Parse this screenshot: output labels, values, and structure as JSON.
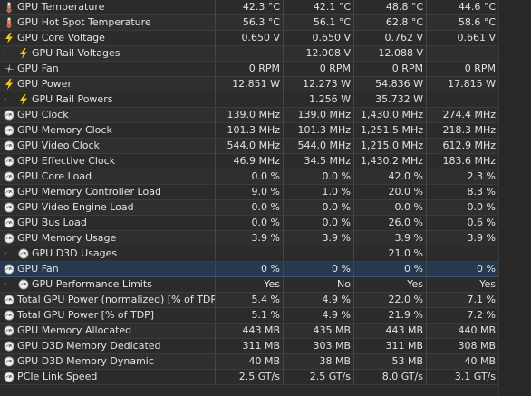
{
  "sensors": [
    {
      "name": "GPU Temperature",
      "icon": "thermometer-icon",
      "values": [
        "42.3 °C",
        "42.1 °C",
        "48.8 °C",
        "44.6 °C"
      ]
    },
    {
      "name": "GPU Hot Spot Temperature",
      "icon": "thermometer-icon",
      "values": [
        "56.3 °C",
        "56.1 °C",
        "62.8 °C",
        "58.6 °C"
      ]
    },
    {
      "name": "GPU Core Voltage",
      "icon": "lightning-icon",
      "values": [
        "0.650 V",
        "0.650 V",
        "0.762 V",
        "0.661 V"
      ]
    },
    {
      "name": "GPU Rail Voltages",
      "icon": "lightning-icon",
      "expandable": true,
      "values": [
        "",
        "12.008 V",
        "12.088 V",
        ""
      ]
    },
    {
      "name": "GPU Fan",
      "icon": "fan-icon",
      "values": [
        "0 RPM",
        "0 RPM",
        "0 RPM",
        "0 RPM"
      ]
    },
    {
      "name": "GPU Power",
      "icon": "lightning-icon",
      "values": [
        "12.851 W",
        "12.273 W",
        "54.836 W",
        "17.815 W"
      ]
    },
    {
      "name": "GPU Rail Powers",
      "icon": "lightning-icon",
      "expandable": true,
      "values": [
        "",
        "1.256 W",
        "35.732 W",
        ""
      ]
    },
    {
      "name": "GPU Clock",
      "icon": "gauge-icon",
      "values": [
        "139.0 MHz",
        "139.0 MHz",
        "1,430.0 MHz",
        "274.4 MHz"
      ]
    },
    {
      "name": "GPU Memory Clock",
      "icon": "gauge-icon",
      "values": [
        "101.3 MHz",
        "101.3 MHz",
        "1,251.5 MHz",
        "218.3 MHz"
      ]
    },
    {
      "name": "GPU Video Clock",
      "icon": "gauge-icon",
      "values": [
        "544.0 MHz",
        "544.0 MHz",
        "1,215.0 MHz",
        "612.9 MHz"
      ]
    },
    {
      "name": "GPU Effective Clock",
      "icon": "gauge-icon",
      "values": [
        "46.9 MHz",
        "34.5 MHz",
        "1,430.2 MHz",
        "183.6 MHz"
      ]
    },
    {
      "name": "GPU Core Load",
      "icon": "gauge-icon",
      "values": [
        "0.0 %",
        "0.0 %",
        "42.0 %",
        "2.3 %"
      ]
    },
    {
      "name": "GPU Memory Controller Load",
      "icon": "gauge-icon",
      "values": [
        "9.0 %",
        "1.0 %",
        "20.0 %",
        "8.3 %"
      ]
    },
    {
      "name": "GPU Video Engine Load",
      "icon": "gauge-icon",
      "values": [
        "0.0 %",
        "0.0 %",
        "0.0 %",
        "0.0 %"
      ]
    },
    {
      "name": "GPU Bus Load",
      "icon": "gauge-icon",
      "values": [
        "0.0 %",
        "0.0 %",
        "26.0 %",
        "0.6 %"
      ]
    },
    {
      "name": "GPU Memory Usage",
      "icon": "gauge-icon",
      "values": [
        "3.9 %",
        "3.9 %",
        "3.9 %",
        "3.9 %"
      ]
    },
    {
      "name": "GPU D3D Usages",
      "icon": "gauge-icon",
      "expandable": true,
      "values": [
        "",
        "",
        "21.0 %",
        ""
      ]
    },
    {
      "name": "GPU Fan",
      "icon": "gauge-icon",
      "selected": true,
      "values": [
        "0 %",
        "0 %",
        "0 %",
        "0 %"
      ]
    },
    {
      "name": "GPU Performance Limits",
      "icon": "gauge-icon",
      "expandable": true,
      "values": [
        "Yes",
        "No",
        "Yes",
        "Yes"
      ]
    },
    {
      "name": "Total GPU Power (normalized) [% of TDP]",
      "icon": "gauge-icon",
      "values": [
        "5.4 %",
        "4.9 %",
        "22.0 %",
        "7.1 %"
      ]
    },
    {
      "name": "Total GPU Power [% of TDP]",
      "icon": "gauge-icon",
      "values": [
        "5.1 %",
        "4.9 %",
        "21.9 %",
        "7.2 %"
      ]
    },
    {
      "name": "GPU Memory Allocated",
      "icon": "gauge-icon",
      "values": [
        "443 MB",
        "435 MB",
        "443 MB",
        "440 MB"
      ]
    },
    {
      "name": "GPU D3D Memory Dedicated",
      "icon": "gauge-icon",
      "values": [
        "311 MB",
        "303 MB",
        "311 MB",
        "308 MB"
      ]
    },
    {
      "name": "GPU D3D Memory Dynamic",
      "icon": "gauge-icon",
      "values": [
        "40 MB",
        "38 MB",
        "53 MB",
        "40 MB"
      ]
    },
    {
      "name": "PCIe Link Speed",
      "icon": "gauge-icon",
      "values": [
        "2.5 GT/s",
        "2.5 GT/s",
        "8.0 GT/s",
        "3.1 GT/s"
      ]
    }
  ],
  "colors": {
    "thermometer": "#e35b2c",
    "lightning": "#f2c618",
    "gauge": "#d9d9d9",
    "fan": "#bdbdbd",
    "selected_row": "#26394f"
  }
}
